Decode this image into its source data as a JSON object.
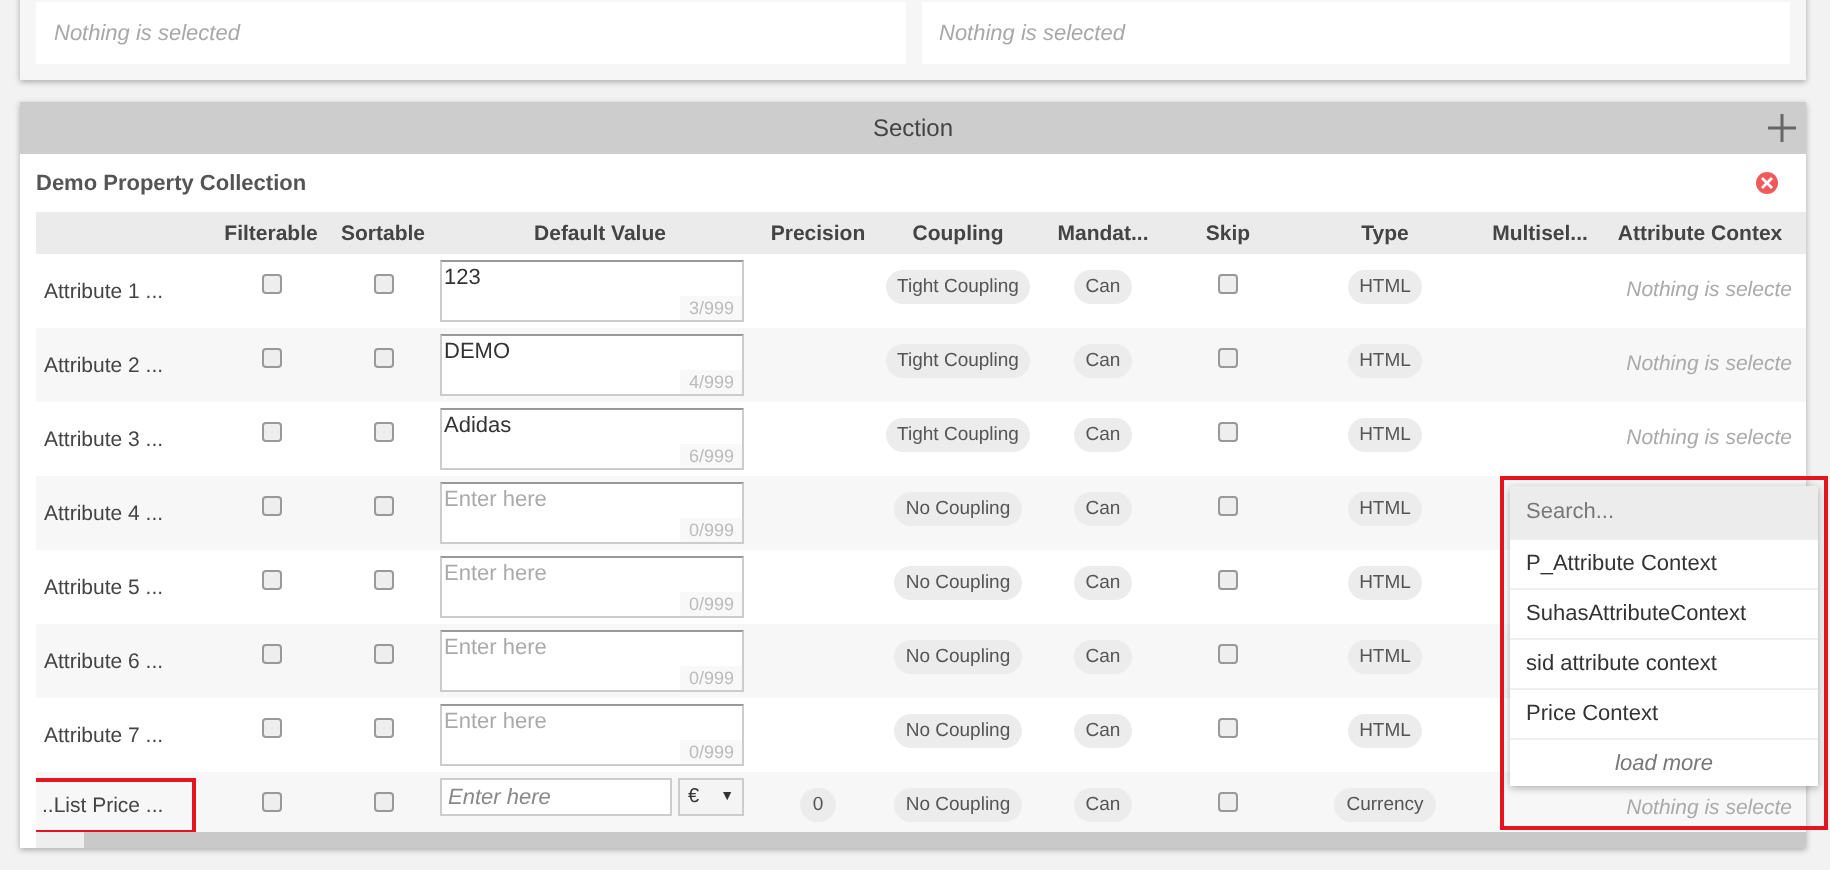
{
  "top_fields": [
    {
      "placeholder": "Nothing is selected"
    },
    {
      "placeholder": "Nothing is selected"
    }
  ],
  "section": {
    "title": "Section",
    "collection_title": "Demo Property Collection",
    "columns": [
      "",
      "Filterable",
      "Sortable",
      "Default Value",
      "Precision",
      "Coupling",
      "Mandat...",
      "Skip",
      "Type",
      "Multisel...",
      "Attribute Contex"
    ],
    "rows": [
      {
        "name": "Attribute 1 ...",
        "filterable": false,
        "sortable": false,
        "default": {
          "kind": "text",
          "value": "123",
          "counter": "3/999"
        },
        "coupling": "Tight Coupling",
        "mandatory": "Can",
        "skip": false,
        "type": "HTML",
        "context": "Nothing is selecte",
        "annotated": false
      },
      {
        "name": "Attribute 2 ...",
        "filterable": false,
        "sortable": false,
        "default": {
          "kind": "text",
          "value": "DEMO",
          "counter": "4/999"
        },
        "coupling": "Tight Coupling",
        "mandatory": "Can",
        "skip": false,
        "type": "HTML",
        "context": "Nothing is selecte",
        "annotated": false
      },
      {
        "name": "Attribute 3 ...",
        "filterable": false,
        "sortable": false,
        "default": {
          "kind": "text",
          "value": "Adidas",
          "counter": "6/999"
        },
        "coupling": "Tight Coupling",
        "mandatory": "Can",
        "skip": false,
        "type": "HTML",
        "context": "Nothing is selecte",
        "annotated": false
      },
      {
        "name": "Attribute 4 ...",
        "filterable": false,
        "sortable": false,
        "default": {
          "kind": "text",
          "placeholder": "Enter here",
          "counter": "0/999"
        },
        "coupling": "No Coupling",
        "mandatory": "Can",
        "skip": false,
        "type": "HTML",
        "annotated": false
      },
      {
        "name": "Attribute 5 ...",
        "filterable": false,
        "sortable": false,
        "default": {
          "kind": "text",
          "placeholder": "Enter here",
          "counter": "0/999"
        },
        "coupling": "No Coupling",
        "mandatory": "Can",
        "skip": false,
        "type": "HTML",
        "annotated": false
      },
      {
        "name": "Attribute 6 ...",
        "filterable": false,
        "sortable": false,
        "default": {
          "kind": "text",
          "placeholder": "Enter here",
          "counter": "0/999"
        },
        "coupling": "No Coupling",
        "mandatory": "Can",
        "skip": false,
        "type": "HTML",
        "annotated": false
      },
      {
        "name": "Attribute 7 ...",
        "filterable": false,
        "sortable": false,
        "default": {
          "kind": "text",
          "placeholder": "Enter here",
          "counter": "0/999"
        },
        "coupling": "No Coupling",
        "mandatory": "Can",
        "skip": false,
        "type": "HTML",
        "annotated": false
      },
      {
        "name": "..List Price ...",
        "filterable": false,
        "sortable": false,
        "default": {
          "kind": "currency",
          "placeholder": "Enter here",
          "currency": "€",
          "caret": "▼"
        },
        "precision": "0",
        "coupling": "No Coupling",
        "mandatory": "Can",
        "skip": false,
        "type": "Currency",
        "context": "Nothing is selecte",
        "annotated": true
      }
    ],
    "dropdown": {
      "annotated": true,
      "search_placeholder": "Search...",
      "options": [
        "P_Attribute Context",
        "SuhasAttributeContext",
        "sid attribute context",
        "Price Context"
      ],
      "load_more": "load more"
    }
  }
}
